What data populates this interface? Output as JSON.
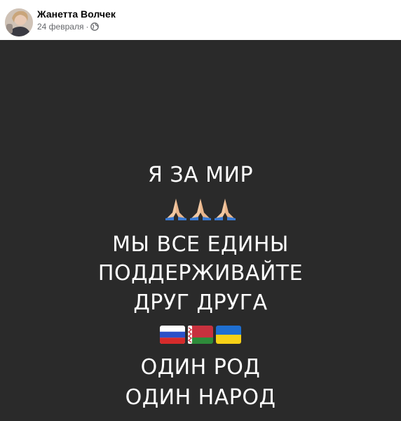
{
  "post": {
    "author": "Жанетта Волчек",
    "date": "24 февраля",
    "separator": "·",
    "privacy_icon": "globe-icon"
  },
  "image": {
    "background": "#2a2a2a",
    "lines": [
      "Я ЗА МИР",
      "МЫ ВСЕ ЕДИНЫ",
      "ПОДДЕРЖИВАЙТЕ",
      "ДРУГ ДРУГА",
      "ОДИН РОД",
      "ОДИН НАРОД"
    ],
    "emoji_row": {
      "icon": "praying-hands-icon",
      "count": 3
    },
    "flags": [
      "russia-flag-icon",
      "belarus-flag-icon",
      "ukraine-flag-icon"
    ]
  }
}
